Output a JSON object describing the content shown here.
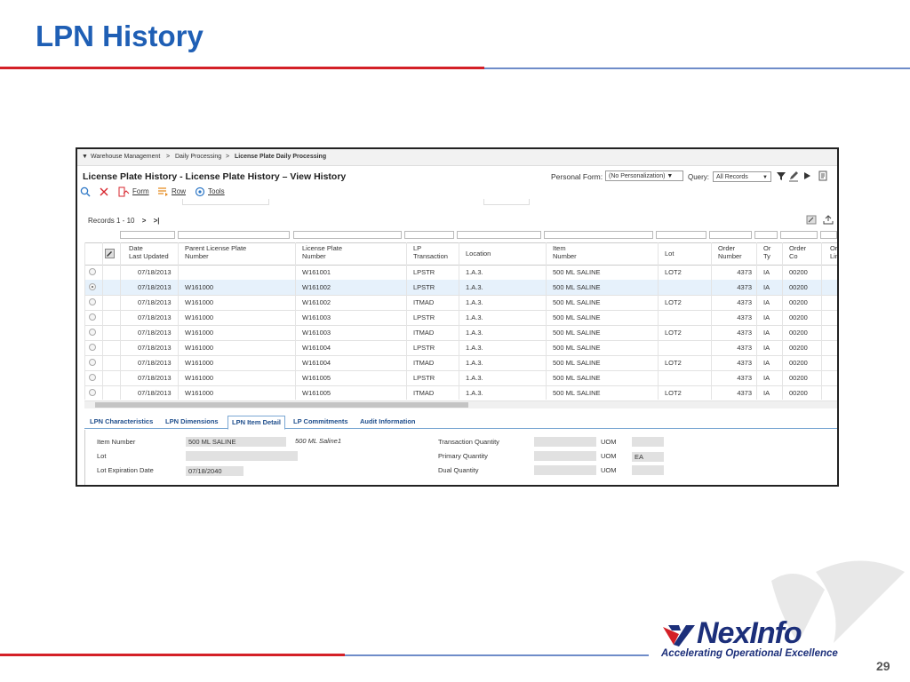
{
  "slide": {
    "title": "LPN History",
    "page_number": "29"
  },
  "logo": {
    "name": "NexInfo",
    "tagline": "Accelerating Operational Excellence"
  },
  "app": {
    "breadcrumb": {
      "toggle": "▼",
      "items": [
        "Warehouse Management",
        "Daily Processing",
        "License Plate Daily Processing"
      ],
      "separator": ">"
    },
    "form_title": "License Plate History - License Plate History – View History",
    "personal_form": {
      "label": "Personal Form:",
      "value": "(No Personalization) ▼"
    },
    "query": {
      "label": "Query:",
      "value": "All Records"
    },
    "toolbar": {
      "form": "Form",
      "row": "Row",
      "tools": "Tools"
    },
    "records": {
      "label": "Records 1 - 10"
    },
    "grid": {
      "columns": [
        {
          "key": "date",
          "label": "Date\nLast Updated"
        },
        {
          "key": "parent",
          "label": "Parent License Plate\nNumber"
        },
        {
          "key": "lpn",
          "label": "License Plate\nNumber"
        },
        {
          "key": "trans",
          "label": "LP\nTransaction"
        },
        {
          "key": "loc",
          "label": "Location"
        },
        {
          "key": "item",
          "label": "Item\nNumber"
        },
        {
          "key": "lot",
          "label": "Lot"
        },
        {
          "key": "order",
          "label": "Order\nNumber"
        },
        {
          "key": "orty",
          "label": "Or\nTy"
        },
        {
          "key": "orco",
          "label": "Order\nCo"
        },
        {
          "key": "orline",
          "label": "Ord\nLine"
        }
      ],
      "rows": [
        {
          "date": "07/18/2013",
          "parent": "",
          "lpn": "W161001",
          "trans": "LPSTR",
          "loc": "1.A.3.",
          "item": "500 ML SALINE",
          "lot": "LOT2",
          "order": "4373",
          "orty": "IA",
          "orco": "00200"
        },
        {
          "date": "07/18/2013",
          "parent": "W161000",
          "lpn": "W161002",
          "trans": "LPSTR",
          "loc": "1.A.3.",
          "item": "500 ML SALINE",
          "lot": "",
          "order": "4373",
          "orty": "IA",
          "orco": "00200"
        },
        {
          "date": "07/18/2013",
          "parent": "W161000",
          "lpn": "W161002",
          "trans": "ITMAD",
          "loc": "1.A.3.",
          "item": "500 ML SALINE",
          "lot": "LOT2",
          "order": "4373",
          "orty": "IA",
          "orco": "00200"
        },
        {
          "date": "07/18/2013",
          "parent": "W161000",
          "lpn": "W161003",
          "trans": "LPSTR",
          "loc": "1.A.3.",
          "item": "500 ML SALINE",
          "lot": "",
          "order": "4373",
          "orty": "IA",
          "orco": "00200"
        },
        {
          "date": "07/18/2013",
          "parent": "W161000",
          "lpn": "W161003",
          "trans": "ITMAD",
          "loc": "1.A.3.",
          "item": "500 ML SALINE",
          "lot": "LOT2",
          "order": "4373",
          "orty": "IA",
          "orco": "00200"
        },
        {
          "date": "07/18/2013",
          "parent": "W161000",
          "lpn": "W161004",
          "trans": "LPSTR",
          "loc": "1.A.3.",
          "item": "500 ML SALINE",
          "lot": "",
          "order": "4373",
          "orty": "IA",
          "orco": "00200"
        },
        {
          "date": "07/18/2013",
          "parent": "W161000",
          "lpn": "W161004",
          "trans": "ITMAD",
          "loc": "1.A.3.",
          "item": "500 ML SALINE",
          "lot": "LOT2",
          "order": "4373",
          "orty": "IA",
          "orco": "00200"
        },
        {
          "date": "07/18/2013",
          "parent": "W161000",
          "lpn": "W161005",
          "trans": "LPSTR",
          "loc": "1.A.3.",
          "item": "500 ML SALINE",
          "lot": "",
          "order": "4373",
          "orty": "IA",
          "orco": "00200"
        },
        {
          "date": "07/18/2013",
          "parent": "W161000",
          "lpn": "W161005",
          "trans": "ITMAD",
          "loc": "1.A.3.",
          "item": "500 ML SALINE",
          "lot": "LOT2",
          "order": "4373",
          "orty": "IA",
          "orco": "00200"
        }
      ],
      "selected_row": 1
    },
    "tabs": [
      "LPN Characteristics",
      "LPN Dimensions",
      "LPN Item Detail",
      "LP Commitments",
      "Audit Information"
    ],
    "active_tab": 2,
    "detail": {
      "item_number": {
        "label": "Item Number",
        "value": "500 ML SALINE",
        "description": "500 ML Saline1"
      },
      "lot": {
        "label": "Lot",
        "value": ""
      },
      "lot_expiration": {
        "label": "Lot Expiration Date",
        "value": "07/18/2040"
      },
      "transaction_quantity": {
        "label": "Transaction Quantity",
        "value": "",
        "uom_label": "UOM",
        "uom": ""
      },
      "primary_quantity": {
        "label": "Primary Quantity",
        "value": "",
        "uom_label": "UOM",
        "uom": "EA"
      },
      "dual_quantity": {
        "label": "Dual Quantity",
        "value": "",
        "uom_label": "UOM",
        "uom": ""
      }
    },
    "icons": [
      "search-icon",
      "close-icon",
      "form-icon",
      "row-icon",
      "tools-icon",
      "filter-icon",
      "edit-icon",
      "play-icon",
      "export-icon",
      "next-icon",
      "last-icon"
    ]
  },
  "colors": {
    "title": "#1f5fb5",
    "red_rule": "#d42027",
    "blue_rule": "#6f8cc9",
    "selected_row": "#e6f1fb",
    "tab_text": "#1f4e8c",
    "logo_navy": "#1c2f7a"
  }
}
